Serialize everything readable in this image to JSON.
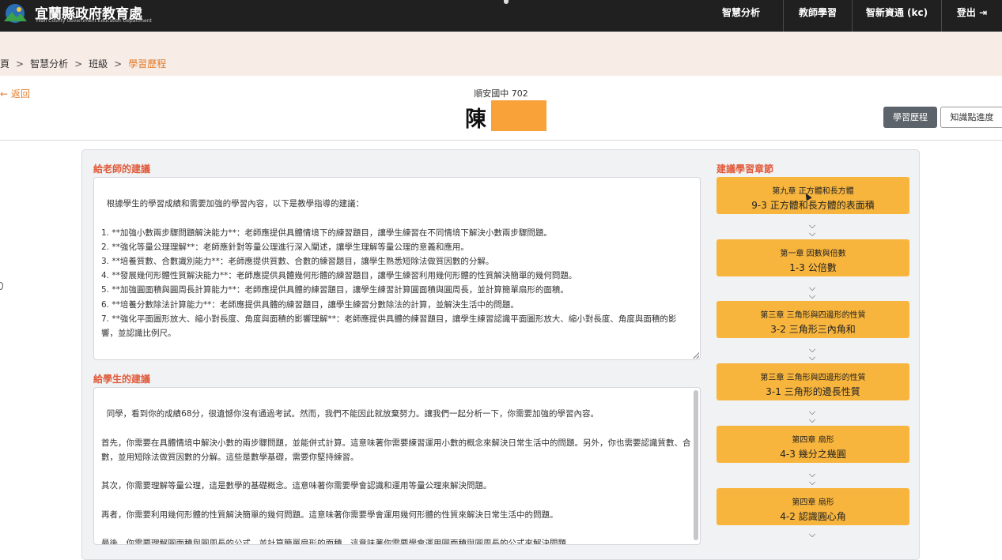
{
  "header": {
    "brand": "宜蘭縣政府教育處",
    "brand_sub": "Yilan County Government Education Department",
    "nav": [
      "智慧分析",
      "教師學習",
      "智新資通 (kc)",
      "登出"
    ]
  },
  "breadcrumb": {
    "items": [
      "頁",
      "智慧分析",
      "班級",
      "學習歷程"
    ]
  },
  "page": {
    "back_label": "返回",
    "school_class": "順安國中 702",
    "student_name": "陳",
    "tab_history": "學習歷程",
    "tab_knowledge": "知識點進度"
  },
  "teacher_advice": {
    "label": "給老師的建議",
    "text": "根據學生的學習成績和需要加強的學習內容，以下是教學指導的建議：\n\n1. **加強小數兩步驟問題解決能力**：老師應提供具體情境下的練習題目，讓學生練習在不同情境下解決小數兩步驟問題。\n2. **強化等量公理理解**：老師應針對等量公理進行深入闡述，讓學生理解等量公理的意義和應用。\n3. **培養質數、合數識別能力**：老師應提供質數、合數的練習題目，讓學生熟悉短除法做質因數的分解。\n4. **發展幾何形體性質解決能力**：老師應提供具體幾何形體的練習題目，讓學生練習利用幾何形體的性質解決簡單的幾何問題。\n5. **加強圓面積與圓周長計算能力**：老師應提供具體的練習題目，讓學生練習計算圓面積與圓周長，並計算簡單扇形的面積。\n6. **培養分數除法計算能力**：老師應提供具體的練習題目，讓學生練習分數除法的計算，並解決生活中的問題。\n7. **強化平面圖形放大、縮小對長度、角度與面積的影響理解**：老師應提供具體的練習題目，讓學生練習認識平面圖形放大、縮小對長度、角度與面積的影響，並認識比例尺。"
  },
  "student_advice": {
    "label": "給學生的建議",
    "text": "同學，看到你的成績68分，很遺憾你沒有通過考試。然而，我們不能因此就放棄努力。讓我們一起分析一下，你需要加強的學習內容。\n\n首先，你需要在具體情境中解決小數的兩步驟問題，並能併式計算。這意味著你需要練習運用小數的概念來解決日常生活中的問題。另外，你也需要認識質數、合數，並用短除法做質因數的分解。這些是數學基礎，需要你堅持練習。\n\n其次，你需要理解等量公理，這是數學的基礎概念。這意味著你需要學會認識和運用等量公理來解決問題。\n\n再者，你需要利用幾何形體的性質解決簡單的幾何問題。這意味著你需要學會運用幾何形體的性質來解決日常生活中的問題。\n\n最後，你需要理解圓面積與圓周長的公式，並計算簡單扇形的面積。這意味著你需要學會運用圓面積與圓周長的公式來解決問題。"
  },
  "chapters": {
    "label": "建議學習章節",
    "items": [
      {
        "chapter": "第九章 正方體和長方體",
        "section": "9-3 正方體和長方體的表面積"
      },
      {
        "chapter": "第一章 因數與倍數",
        "section": "1-3 公倍數"
      },
      {
        "chapter": "第三章 三角形與四邊形的性質",
        "section": "3-2 三角形三內角和"
      },
      {
        "chapter": "第三章 三角形與四邊形的性質",
        "section": "3-1 三角形的邊長性質"
      },
      {
        "chapter": "第四章 扇形",
        "section": "4-3 幾分之幾圓"
      },
      {
        "chapter": "第四章 扇形",
        "section": "4-2 認識圓心角"
      }
    ]
  },
  "colors": {
    "header_bg": "#202020",
    "breadcrumb_bg": "#f8ece6",
    "accent": "#e07b2a",
    "chapter_bg": "#f8b53e",
    "section_label": "#e05a3a"
  }
}
